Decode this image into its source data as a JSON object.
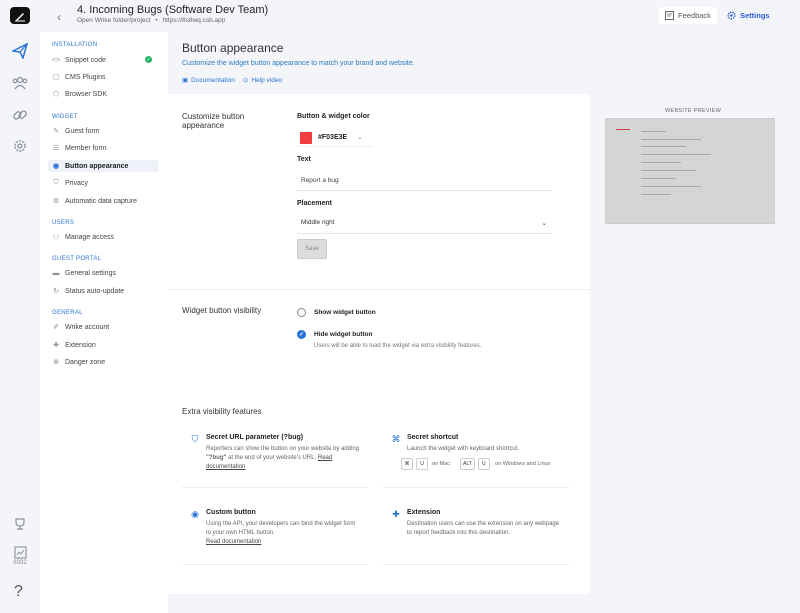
{
  "header": {
    "back_icon": "chevron-left-icon",
    "project_title": "4. Incoming Bugs (Software Dev Team)",
    "project_sub": "Open Wrike folder/project",
    "project_bullet": "•",
    "project_url": "https://8s8wq.csb.app",
    "feedback_label": "Feedback",
    "settings_label": "Settings"
  },
  "rail": {
    "icons": [
      "paper-plane-icon",
      "users-icon",
      "link-icon",
      "gear-icon",
      "trophy-icon",
      "stats-icon"
    ],
    "bottom_label": "8392",
    "help_glyph": "?"
  },
  "sidebar": {
    "sections": [
      {
        "title": "INSTALLATION",
        "items": [
          {
            "label": "Snippet code",
            "icon": "code-icon",
            "done": true
          },
          {
            "label": "CMS Plugins",
            "icon": "plugin-icon"
          },
          {
            "label": "Browser SDK",
            "icon": "box-icon"
          }
        ]
      },
      {
        "title": "WIDGET",
        "items": [
          {
            "label": "Guest form",
            "icon": "edit-icon"
          },
          {
            "label": "Member form",
            "icon": "form-icon"
          },
          {
            "label": "Button appearance",
            "icon": "palette-icon",
            "active": true
          },
          {
            "label": "Privacy",
            "icon": "shield-icon"
          },
          {
            "label": "Automatic data capture",
            "icon": "gear-small-icon"
          }
        ]
      },
      {
        "title": "USERS",
        "items": [
          {
            "label": "Manage access",
            "icon": "people-icon"
          }
        ]
      },
      {
        "title": "GUEST PORTAL",
        "items": [
          {
            "label": "General settings",
            "icon": "folder-icon"
          },
          {
            "label": "Status auto-update",
            "icon": "refresh-icon"
          }
        ]
      },
      {
        "title": "GENERAL",
        "items": [
          {
            "label": "Wrike account",
            "icon": "pen-icon"
          },
          {
            "label": "Extension",
            "icon": "puzzle-icon"
          },
          {
            "label": "Danger zone",
            "icon": "warning-icon"
          }
        ]
      }
    ],
    "check_glyph": "✓"
  },
  "main": {
    "title": "Button appearance",
    "description": "Customize the widget button appearance to match your brand and website.",
    "doc_link": "Documentation",
    "help_link": "Help video",
    "customize": {
      "section_label": "Customize button appearance",
      "color_label": "Button & widget color",
      "color_value": "#F03E3E",
      "color_hex": "#F03E3E",
      "text_label": "Text",
      "text_value": "Report a bug",
      "placement_label": "Placement",
      "placement_value": "Middle right",
      "save_label": "Save"
    },
    "visibility": {
      "section_label": "Widget button visibility",
      "option_show": "Show widget button",
      "option_hide": "Hide widget button",
      "selected": "hide",
      "hide_desc": "Users will be able to load the widget via extra visibility features."
    },
    "extra": {
      "title": "Extra visibility features",
      "secret_url": {
        "title": "Secret URL parameter (?bug)",
        "desc_1": "Reporters can show the button on your website by adding ",
        "desc_bold": "\"?bug\"",
        "desc_2": " at the end of your website's URL. ",
        "link": "Read documentation"
      },
      "shortcut": {
        "title": "Secret shortcut",
        "desc": "Launch the widget with keyboard shortcut.",
        "mac_key_1": "⌘",
        "mac_key_2": "U",
        "mac_label": "on Mac",
        "win_key_1": "ALT",
        "win_key_2": "U",
        "win_label": "on Windows and Linux"
      },
      "custom_button": {
        "title": "Custom button",
        "desc": "Using the API, your developers can bind the widget form to your own HTML button.",
        "link": "Read documentation"
      },
      "extension": {
        "title": "Extension",
        "desc": "Destination users can use the extension on any webpage to report feedback into this destination."
      }
    },
    "preview": {
      "label": "WEBSITE PREVIEW"
    }
  }
}
